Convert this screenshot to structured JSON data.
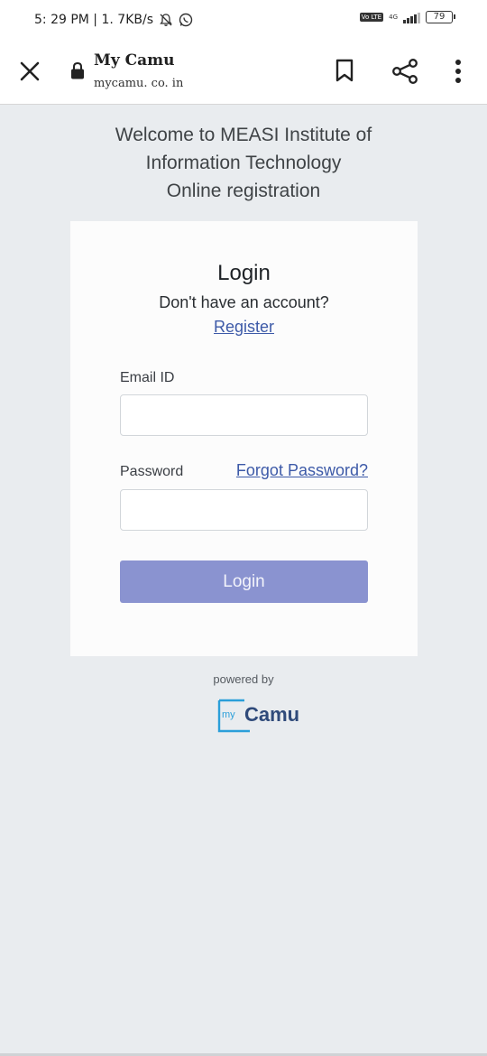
{
  "status_bar": {
    "time_speed": "5: 29 PM | 1. 7KB/s",
    "volte": "Vo LTE",
    "network": "4G",
    "battery": "79",
    "icons": [
      "mute-bell-icon",
      "whatsapp-icon",
      "signal-icon",
      "battery-icon"
    ]
  },
  "browser": {
    "title": "My Camu",
    "url": "mycamu. co. in",
    "icons": [
      "close-icon",
      "lock-icon",
      "bookmark-icon",
      "share-icon",
      "more-vert-icon"
    ]
  },
  "welcome": {
    "line1": "Welcome to MEASI Institute of",
    "line2": "Information Technology",
    "line3": "Online registration"
  },
  "login_card": {
    "title": "Login",
    "no_account": "Don't have an account?",
    "register_link": "Register",
    "email_label": "Email ID",
    "email_value": "",
    "password_label": "Password",
    "forgot_link": "Forgot Password?",
    "password_value": "",
    "login_button": "Login"
  },
  "footer": {
    "powered_by": "powered by",
    "logo_prefix": "my",
    "logo_text": "Camu"
  },
  "colors": {
    "page_bg": "#e9ecef",
    "card_bg": "#fcfcfc",
    "link": "#3d5aa8",
    "button": "#8a93d0",
    "logo_blue": "#2b9fd9",
    "logo_navy": "#2f4a7a"
  }
}
